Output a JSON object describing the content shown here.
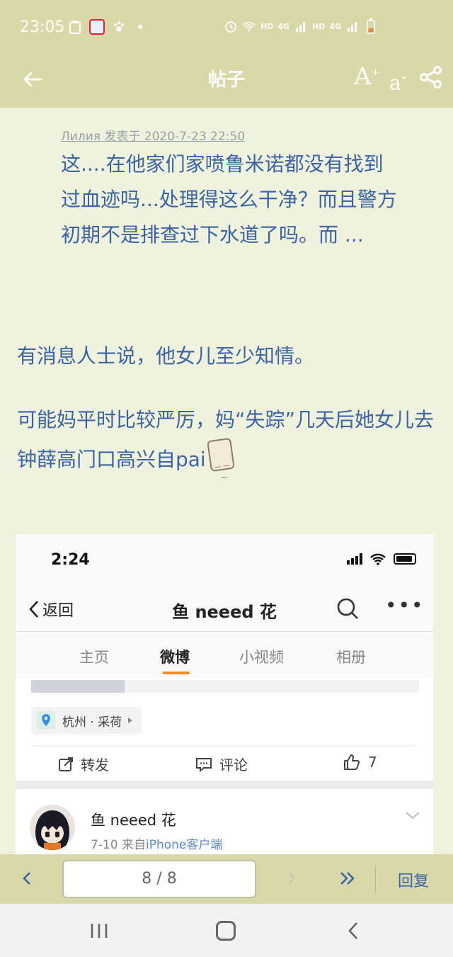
{
  "status_bar": {
    "time": "23:05",
    "net_label_1": "HD",
    "net_label_2": "4G",
    "net_label_3": "HD",
    "net_label_4": "4G"
  },
  "app_bar": {
    "title": "帖子",
    "font_up_label": "A",
    "font_down_label": "a"
  },
  "quote": {
    "meta": "Лилия 发表于 2020-7-23 22:50",
    "text": "这....在他家们家喷鲁米诺都没有找到过血迹吗...处理得这么干净？而且警方初期不是排查过下水道了吗。而 ..."
  },
  "post": {
    "paragraph_1": "有消息人士说，他女儿至少知情。",
    "paragraph_2": "可能妈平时比较严厉，妈“失踪”几天后她女儿去钟薛高门口高兴自pai"
  },
  "embedded_screenshot": {
    "time": "2:24",
    "back_label": "返回",
    "profile_title": "鱼 neeed 花",
    "tabs": [
      {
        "label": "主页"
      },
      {
        "label": "微博"
      },
      {
        "label": "小视频"
      },
      {
        "label": "相册"
      }
    ],
    "location": "杭州 · 采荷",
    "actions": {
      "repost": "转发",
      "comment": "评论",
      "like_count": "7"
    },
    "next_post": {
      "author": "鱼 neeed 花",
      "date": "7-10",
      "from_label": "来自",
      "source": "iPhone客户端"
    }
  },
  "pager": {
    "page_indicator": "8 / 8",
    "reply_label": "回复"
  },
  "colors": {
    "header_bg": "#d8d8a8",
    "page_bg": "#eff2dc",
    "text_blue": "#3b63a6",
    "weibo_tab_accent": "#f08a2a"
  }
}
